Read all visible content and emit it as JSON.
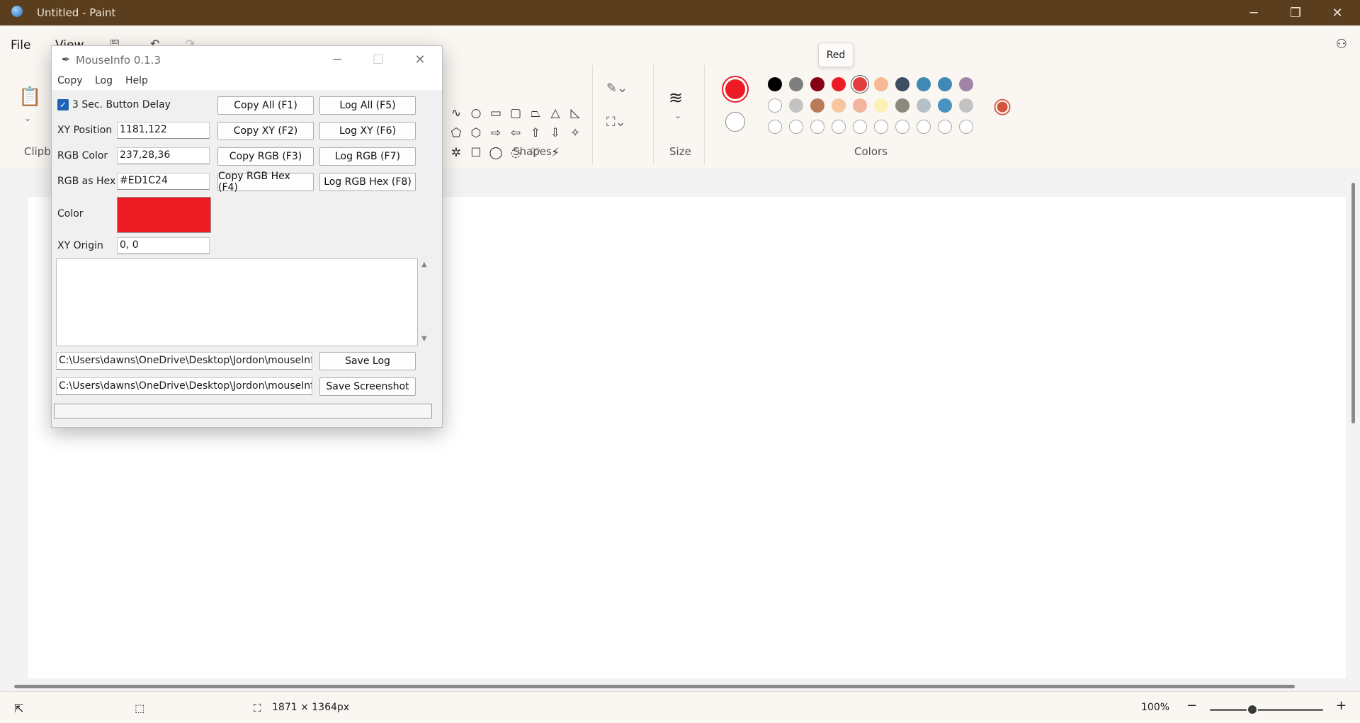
{
  "window": {
    "title": "Untitled - Paint",
    "min": "─",
    "max": "❐",
    "close": "✕"
  },
  "menu": {
    "file": "File",
    "view": "View"
  },
  "groups": {
    "clipboard": "Clipbo",
    "shapes": "Shapes",
    "size": "Size",
    "colors": "Colors"
  },
  "tooltip": "Red",
  "shapes": [
    "∿",
    "○",
    "▭",
    "▢",
    "⏢",
    "△",
    "◺",
    "⬠",
    "⬡",
    "⇨",
    "⇦",
    "⇧",
    "⇩",
    "✧",
    "✲",
    "☐",
    "◯",
    "◌",
    "♡",
    "⚡"
  ],
  "colors": {
    "primary": "#ED1C24",
    "secondary": "#FFFFFF",
    "row1": [
      "#000000",
      "#7f7f7f",
      "#880015",
      "#ed1c24",
      "#e63e3e",
      "#f6b995",
      "#3f4d63",
      "#4089b5",
      "#4089b5",
      "#a284a6"
    ],
    "row2": [
      "#ffffff",
      "#c3c3c3",
      "#b97a57",
      "#f7c6a0",
      "#f2b49a",
      "#fdf0b5",
      "#8a8a7d",
      "#b6c1c7",
      "#4a92c0",
      "#c3c3c3"
    ]
  },
  "status": {
    "canvas_size": "1871 × 1364px",
    "zoom": "100%"
  },
  "mouseinfo": {
    "title": "MouseInfo 0.1.3",
    "menu": [
      "Copy",
      "Log",
      "Help"
    ],
    "delay_label": "3 Sec. Button Delay",
    "xy_label": "XY Position",
    "xy_value": "1181,122",
    "rgb_label": "RGB Color",
    "rgb_value": "237,28,36",
    "hex_label": "RGB as Hex",
    "hex_value": "#ED1C24",
    "color_label": "Color",
    "color_value": "#ED1C24",
    "origin_label": "XY Origin",
    "origin_value": "0, 0",
    "buttons": {
      "copy_all": "Copy All (F1)",
      "log_all": "Log All (F5)",
      "copy_xy": "Copy XY (F2)",
      "log_xy": "Log XY (F6)",
      "copy_rgb": "Copy RGB (F3)",
      "log_rgb": "Log RGB (F7)",
      "copy_hex": "Copy RGB Hex (F4)",
      "log_hex": "Log RGB Hex (F8)",
      "save_log": "Save Log",
      "save_screenshot": "Save Screenshot"
    },
    "log_path": "C:\\Users\\dawns\\OneDrive\\Desktop\\Jordon\\mouseInfo",
    "screenshot_path": "C:\\Users\\dawns\\OneDrive\\Desktop\\Jordon\\mouseInfo"
  }
}
